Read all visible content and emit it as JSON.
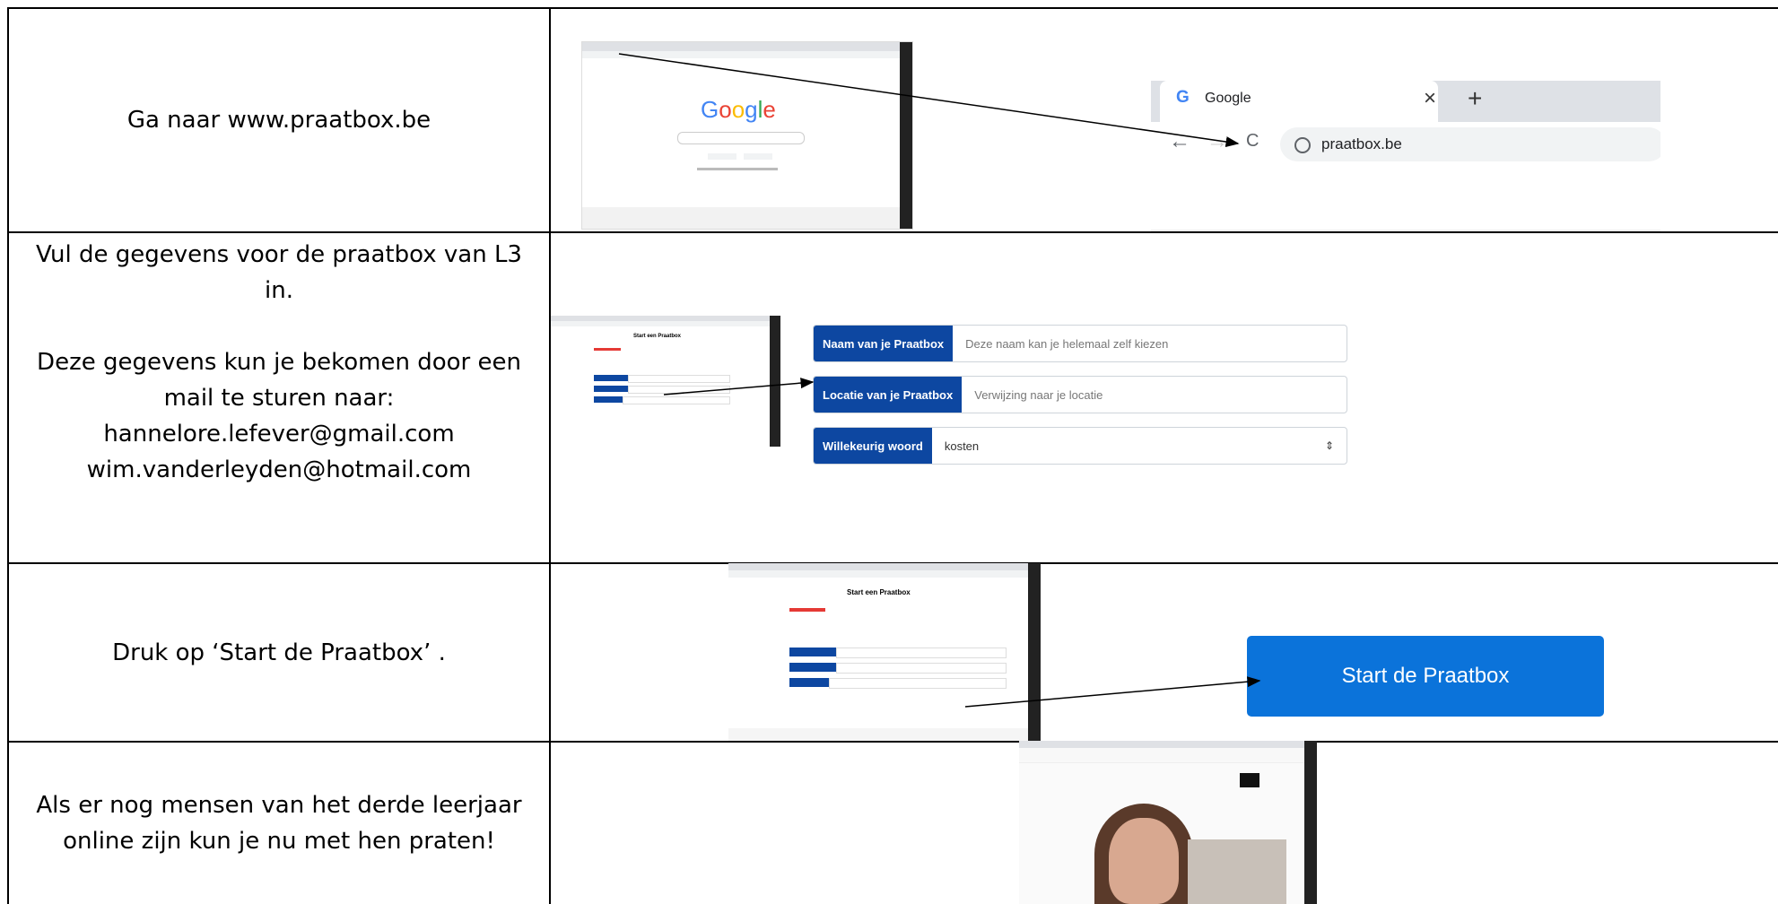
{
  "rows": [
    {
      "instruction": "Ga naar www.praatbox.be"
    },
    {
      "instruction_lines": [
        "Vul de gegevens voor de praatbox van L3",
        "in.",
        "",
        "Deze gegevens kun je bekomen door een",
        "mail te sturen naar:",
        "hannelore.lefever@gmail.com",
        "wim.vanderleyden@hotmail.com"
      ]
    },
    {
      "instruction": "Druk op ‘Start de Praatbox’ ."
    },
    {
      "instruction_lines": [
        "Als er nog mensen van het derde leerjaar",
        "online zijn kun je nu met hen praten!"
      ]
    }
  ],
  "browser_zoom": {
    "tab_title": "Google",
    "close_glyph": "×",
    "new_tab_glyph": "+",
    "back_glyph": "←",
    "forward_glyph": "→",
    "reload_glyph": "C",
    "url": "praatbox.be"
  },
  "google_logo": [
    "G",
    "o",
    "o",
    "g",
    "l",
    "e"
  ],
  "form": {
    "name_label": "Naam van je Praatbox",
    "name_placeholder": "Deze naam kan je helemaal zelf kiezen",
    "location_label": "Locatie van je Praatbox",
    "location_placeholder": "Verwijzing naar je locatie",
    "word_label": "Willekeurig woord",
    "word_value": "kosten",
    "select_glyph": "⇕"
  },
  "mini_form_title": "Start een Praatbox",
  "start_button": "Start de Praatbox",
  "colors": {
    "form_label_bg": "#0d47a1",
    "start_button_bg": "#0b73da",
    "google_blue": "#4285f4",
    "google_red": "#ea4335",
    "google_yellow": "#fbbc05",
    "google_green": "#34a853"
  }
}
